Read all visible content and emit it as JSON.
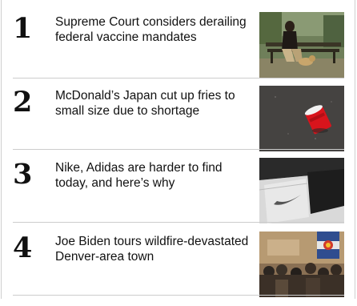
{
  "stories": [
    {
      "rank": "1",
      "headline": "Supreme Court considers derailing federal vaccine mandates",
      "thumbnail_icon": "park-bench-photo-icon"
    },
    {
      "rank": "2",
      "headline": "McDonald’s Japan cut up fries to small size due to shortage",
      "thumbnail_icon": "fries-box-photo-icon"
    },
    {
      "rank": "3",
      "headline": "Nike, Adidas are harder to find today, and here’s why",
      "thumbnail_icon": "shoebox-photo-icon"
    },
    {
      "rank": "4",
      "headline": "Joe Biden tours wildfire-devastated Denver-area town",
      "thumbnail_icon": "town-hall-photo-icon"
    }
  ],
  "colors": {
    "divider": "#cccccc",
    "text": "#111111",
    "border": "#cfcfcf"
  }
}
